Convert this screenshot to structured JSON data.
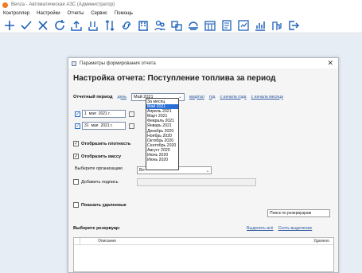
{
  "window": {
    "title": "Benza - Автоматическая АЗС (Администратор)"
  },
  "menu": {
    "items": [
      "Контроллер",
      "Настройки",
      "Отчеты",
      "Сервис",
      "Помощь"
    ]
  },
  "toolbar": {
    "icons": [
      "plus-icon",
      "check-icon",
      "close-icon",
      "refresh-icon",
      "upload-icon",
      "upload-stack-icon",
      "sort-icon",
      "link-icon",
      "building-icon",
      "users-icon",
      "transfer-icon",
      "tank-icon",
      "calendar-grid-icon",
      "document-icon",
      "report-icon",
      "bar-chart-icon",
      "pumps-icon",
      "logout-icon"
    ],
    "accent": "#1e62b8"
  },
  "dialog": {
    "title": "Параметры формирования отчета",
    "heading": "Настройка отчета: Поступление топлива за период",
    "period_label": "Отчетный период",
    "period_links": {
      "day": "день",
      "quarter": "квартал",
      "year": "год",
      "year_start": "с начала года",
      "month_start": "с начала месяца"
    },
    "month_select": "Май 2021",
    "date_from": {
      "day": "1",
      "month": "мая",
      "year": "2021 г."
    },
    "date_to": {
      "day": "31",
      "month": "мая",
      "year": "2021 г."
    },
    "options": {
      "show_density": "Отобразить плотность",
      "show_mass": "Отобразить массу",
      "choose_org": "Выберите организацию",
      "org_value": "Во",
      "add_signature": "Добавить подпись",
      "show_deleted": "Показать удаленные"
    },
    "search_placeholder": "Поиск по резервуарам",
    "reservoir_label": "Выберите резервуар:",
    "select_all": "Выделить всё",
    "clear_selection": "Снять выделение",
    "grid_headers": {
      "description": "Описание",
      "deleted": "Удалено"
    }
  },
  "dropdown": {
    "items": [
      "За месяц",
      "Май 2021",
      "Апрель 2021",
      "Март 2021",
      "Февраль 2021",
      "Январь 2021",
      "Декабрь 2020",
      "Ноябрь 2020",
      "Октябрь 2020",
      "Сентябрь 2020",
      "Август 2020",
      "Июль 2020",
      "Июнь 2020"
    ],
    "selected": "Май 2021",
    "highlight_color": "#2b6fd6"
  }
}
